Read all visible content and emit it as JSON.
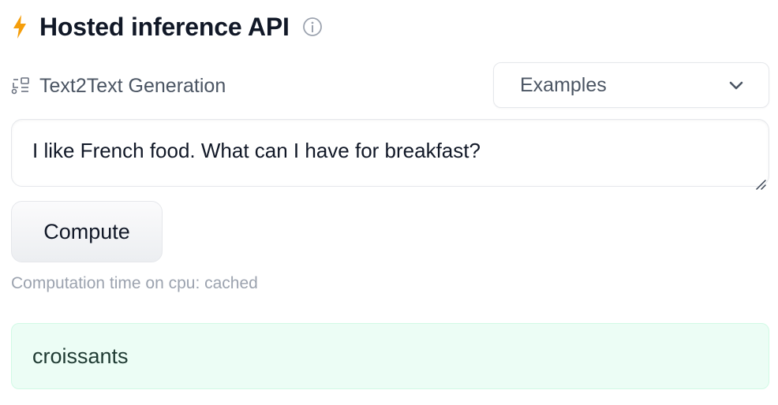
{
  "header": {
    "title": "Hosted inference API",
    "bolt_icon": "lightning-icon",
    "info_icon": "info-icon"
  },
  "task": {
    "icon": "text2text-icon",
    "label": "Text2Text Generation"
  },
  "examples_dropdown": {
    "label": "Examples",
    "icon": "chevron-down-icon"
  },
  "input": {
    "value": "I like French food. What can I have for breakfast?"
  },
  "compute_button": {
    "label": "Compute"
  },
  "status": {
    "computation_time": "Computation time on cpu: cached"
  },
  "output": {
    "value": "croissants"
  },
  "colors": {
    "accent_bolt": "#f59e0b",
    "output_bg": "#ecfdf5",
    "output_border": "#d1fae5"
  }
}
